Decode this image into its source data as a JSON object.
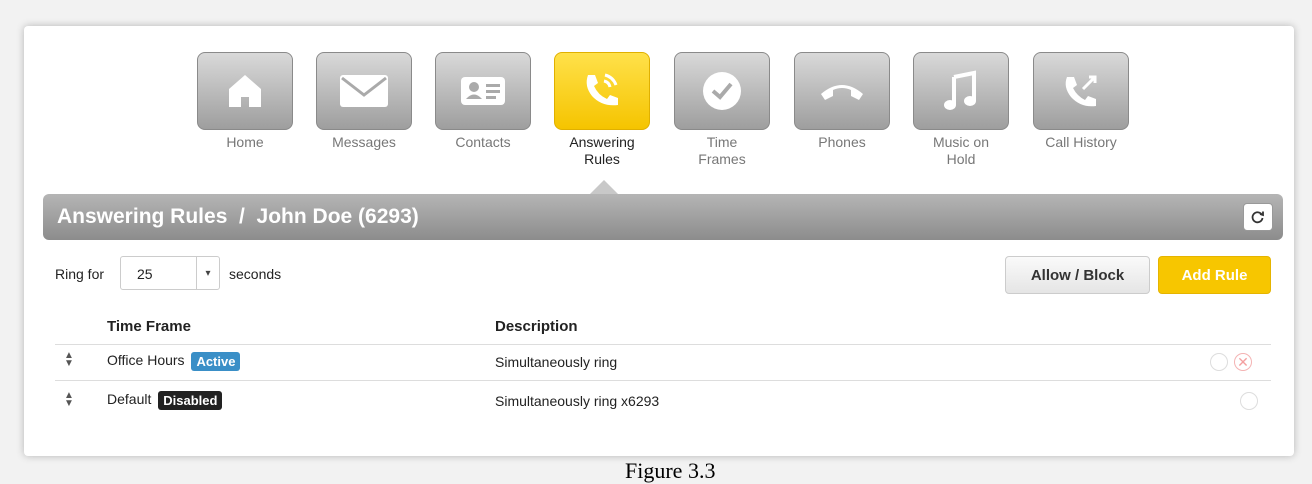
{
  "nav": [
    {
      "label": "Home",
      "icon": "home-icon",
      "active": false
    },
    {
      "label": "Messages",
      "icon": "envelope-icon",
      "active": false
    },
    {
      "label": "Contacts",
      "icon": "contact-card-icon",
      "active": false
    },
    {
      "label": "Answering\nRules",
      "icon": "phone-ringing-icon",
      "active": true
    },
    {
      "label": "Time\nFrames",
      "icon": "clock-icon",
      "active": false
    },
    {
      "label": "Phones",
      "icon": "handset-icon",
      "active": false
    },
    {
      "label": "Music on\nHold",
      "icon": "music-note-icon",
      "active": false
    },
    {
      "label": "Call History",
      "icon": "call-history-icon",
      "active": false
    }
  ],
  "header": {
    "title": "Answering Rules  /  John Doe (6293)"
  },
  "ring": {
    "label": "Ring for",
    "value": "25",
    "suffix": "seconds"
  },
  "buttons": {
    "allow_block": "Allow / Block",
    "add_rule": "Add Rule"
  },
  "table": {
    "columns": [
      "Time Frame",
      "Description"
    ],
    "rows": [
      {
        "time_frame": "Office Hours",
        "status": "Active",
        "description": "Simultaneously ring"
      },
      {
        "time_frame": "Default",
        "status": "Disabled",
        "description": "Simultaneously ring x6293"
      }
    ]
  },
  "colors": {
    "accent": "#f7c600",
    "active_badge": "#3a8fc7",
    "disabled_badge": "#222222"
  },
  "caption": "Figure 3.3"
}
